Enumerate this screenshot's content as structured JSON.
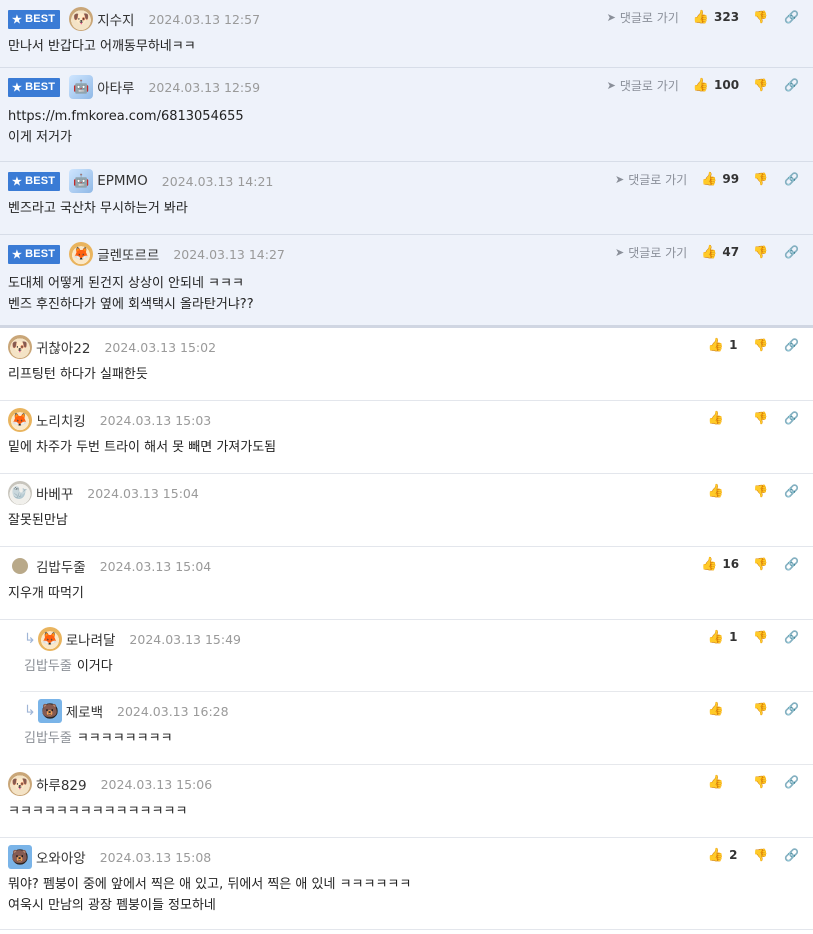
{
  "comments": [
    {
      "best": true,
      "nick": "지수지",
      "avatar": "dog-avatar",
      "date": "2024.03.13 12:57",
      "goto": "댓글로 가기",
      "likes": "323",
      "lines": [
        "만나서 반갑다고 어깨동무하네ㅋㅋ"
      ]
    },
    {
      "best": true,
      "nick": "아타루",
      "avatar": "robot-avatar",
      "date": "2024.03.13 12:59",
      "goto": "댓글로 가기",
      "likes": "100",
      "lines": [
        "https://m.fmkorea.com/6813054655",
        "이게 저거가"
      ]
    },
    {
      "best": true,
      "nick": "EPMMO",
      "avatar": "robot-avatar",
      "date": "2024.03.13 14:21",
      "goto": "댓글로 가기",
      "likes": "99",
      "lines": [
        "벤즈라고 국산차 무시하는거 봐라"
      ]
    },
    {
      "best": true,
      "nick": "글렌또르르",
      "avatar": "fox-avatar",
      "date": "2024.03.13 14:27",
      "goto": "댓글로 가기",
      "likes": "47",
      "lines": [
        "도대체 어떻게 된건지 상상이 안되네 ㅋㅋㅋ",
        "벤즈 후진하다가 옆에 회색택시 올라탄거냐??"
      ]
    },
    {
      "best": false,
      "nick": "귀찮아22",
      "avatar": "dog-avatar",
      "date": "2024.03.13 15:02",
      "likes": "1",
      "lines": [
        "리프팅턴 하다가 실패한듯"
      ]
    },
    {
      "best": false,
      "nick": "노리치킹",
      "avatar": "fox-avatar",
      "date": "2024.03.13 15:03",
      "likes": "",
      "lines": [
        "밑에 차주가 두번 트라이 해서 못 빼면 가져가도됨"
      ]
    },
    {
      "best": false,
      "nick": "바베꾸",
      "avatar": "seal-avatar",
      "date": "2024.03.13 15:04",
      "likes": "",
      "lines": [
        "잘못된만남"
      ]
    },
    {
      "best": false,
      "nick": "김밥두줄",
      "avatar": "blob-avatar",
      "date": "2024.03.13 15:04",
      "likes": "16",
      "lines": [
        "지우개 따먹기"
      ]
    },
    {
      "best": false,
      "reply": true,
      "nick": "로나려달",
      "avatar": "fox-avatar",
      "date": "2024.03.13 15:49",
      "likes": "1",
      "mention": "김밥두줄",
      "lines": [
        "이거다"
      ]
    },
    {
      "best": false,
      "reply": true,
      "nick": "제로백",
      "avatar": "bear-avatar",
      "date": "2024.03.13 16:28",
      "likes": "",
      "mention": "김밥두줄",
      "lines": [
        "ㅋㅋㅋㅋㅋㅋㅋㅋ"
      ]
    },
    {
      "best": false,
      "nick": "하루829",
      "avatar": "dog-avatar",
      "date": "2024.03.13 15:06",
      "likes": "",
      "lines": [
        "ㅋㅋㅋㅋㅋㅋㅋㅋㅋㅋㅋㅋㅋㅋㅋ"
      ]
    },
    {
      "best": false,
      "nick": "오와아앙",
      "avatar": "bear-avatar",
      "date": "2024.03.13 15:08",
      "likes": "2",
      "lines": [
        "뭐야? 펨붕이 중에 앞에서 찍은 애 있고, 뒤에서 찍은 애 있네 ㅋㅋㅋㅋㅋㅋ",
        "여욱시 만남의 광장 펨붕이들 정모하네"
      ]
    }
  ],
  "labels": {
    "best_badge": "BEST"
  },
  "colors": {
    "best_background": "#eef2fa",
    "badge": "#3a7bd5"
  }
}
